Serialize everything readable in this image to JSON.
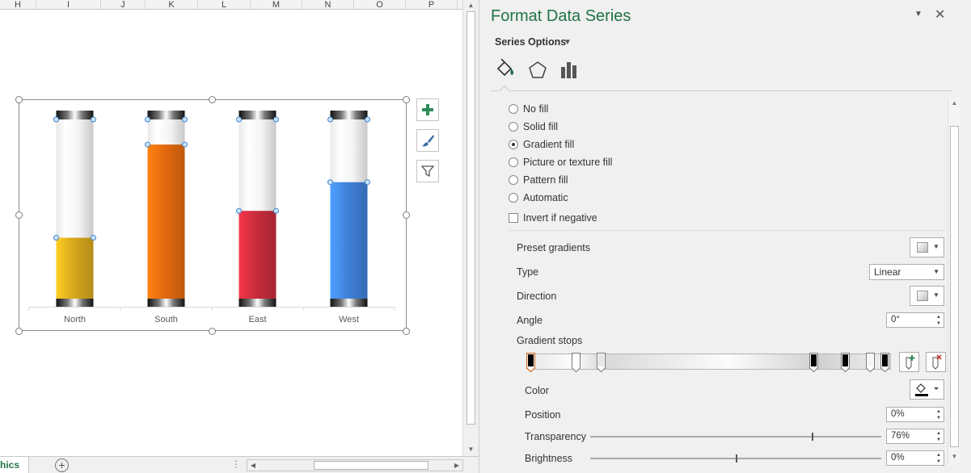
{
  "columns": [
    "H",
    "I",
    "J",
    "K",
    "L",
    "M",
    "N",
    "O",
    "P"
  ],
  "sheet": {
    "tab_label": "hics",
    "dots": "⋮"
  },
  "chart_data": {
    "type": "bar",
    "categories": [
      "North",
      "South",
      "East",
      "West"
    ],
    "values": [
      34,
      86,
      49,
      65
    ],
    "ylim": [
      0,
      100
    ],
    "colors": [
      "#d4a51c",
      "#e0680e",
      "#c42b3a",
      "#3f7fd6"
    ],
    "tube_color": "#eeeeee"
  },
  "pane": {
    "title": "Format Data Series",
    "series_options": "Series Options",
    "fill_options": [
      {
        "label": "No fill",
        "selected": false
      },
      {
        "label": "Solid fill",
        "selected": false
      },
      {
        "label": "Gradient fill",
        "selected": true
      },
      {
        "label": "Picture or texture fill",
        "selected": false
      },
      {
        "label": "Pattern fill",
        "selected": false
      },
      {
        "label": "Automatic",
        "selected": false
      }
    ],
    "invert_if_negative": "Invert if negative",
    "preset_gradients": "Preset gradients",
    "type_label": "Type",
    "type_value": "Linear",
    "direction_label": "Direction",
    "angle_label": "Angle",
    "angle_value": "0°",
    "gradient_stops_label": "Gradient stops",
    "color_label": "Color",
    "position_label": "Position",
    "position_value": "0%",
    "transparency_label": "Transparency",
    "transparency_value": "76%",
    "transparency_level": 0.76,
    "brightness_label": "Brightness",
    "brightness_value": "0%",
    "brightness_level": 0.5
  }
}
